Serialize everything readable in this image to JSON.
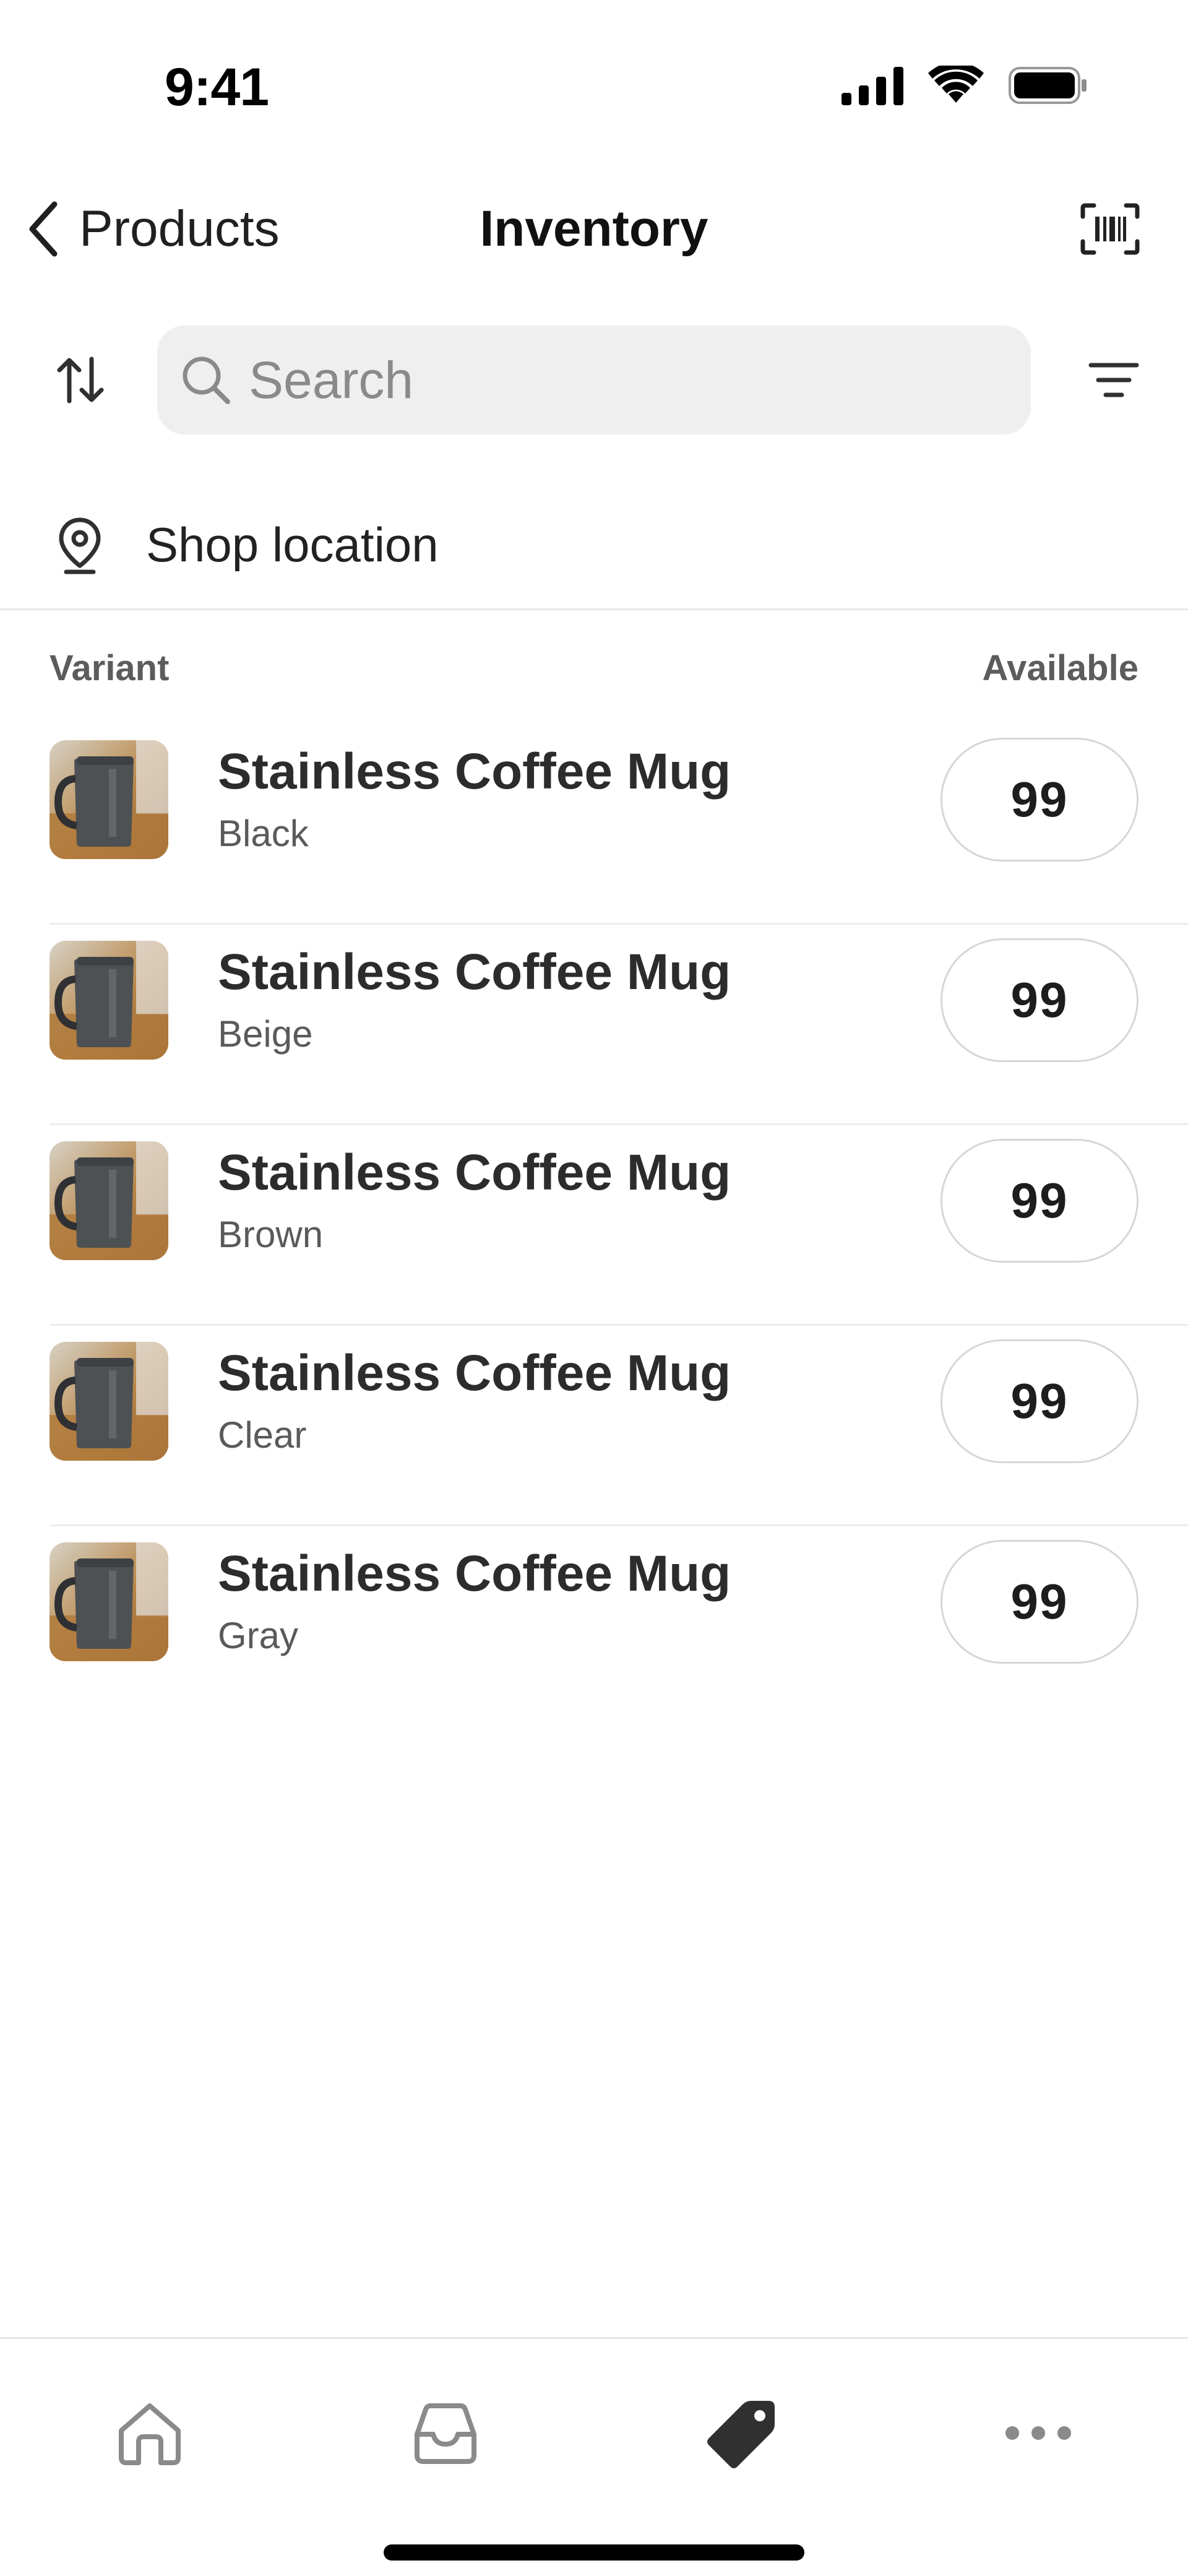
{
  "status_bar": {
    "time": "9:41"
  },
  "nav": {
    "back_label": "Products",
    "title": "Inventory"
  },
  "search": {
    "placeholder": "Search",
    "value": ""
  },
  "location": {
    "label": "Shop location"
  },
  "list_header": {
    "left": "Variant",
    "right": "Available"
  },
  "items": [
    {
      "title": "Stainless Coffee Mug",
      "variant": "Black",
      "available": "99"
    },
    {
      "title": "Stainless Coffee Mug",
      "variant": "Beige",
      "available": "99"
    },
    {
      "title": "Stainless Coffee Mug",
      "variant": "Brown",
      "available": "99"
    },
    {
      "title": "Stainless Coffee Mug",
      "variant": "Clear",
      "available": "99"
    },
    {
      "title": "Stainless Coffee Mug",
      "variant": "Gray",
      "available": "99"
    }
  ],
  "tabs": [
    {
      "icon": "home-icon"
    },
    {
      "icon": "inbox-icon"
    },
    {
      "icon": "tag-icon",
      "active": true
    },
    {
      "icon": "more-icon"
    }
  ],
  "colors": {
    "active_icon": "#303030",
    "inactive_icon": "#8a8a8a",
    "search_bg": "#efefef"
  }
}
